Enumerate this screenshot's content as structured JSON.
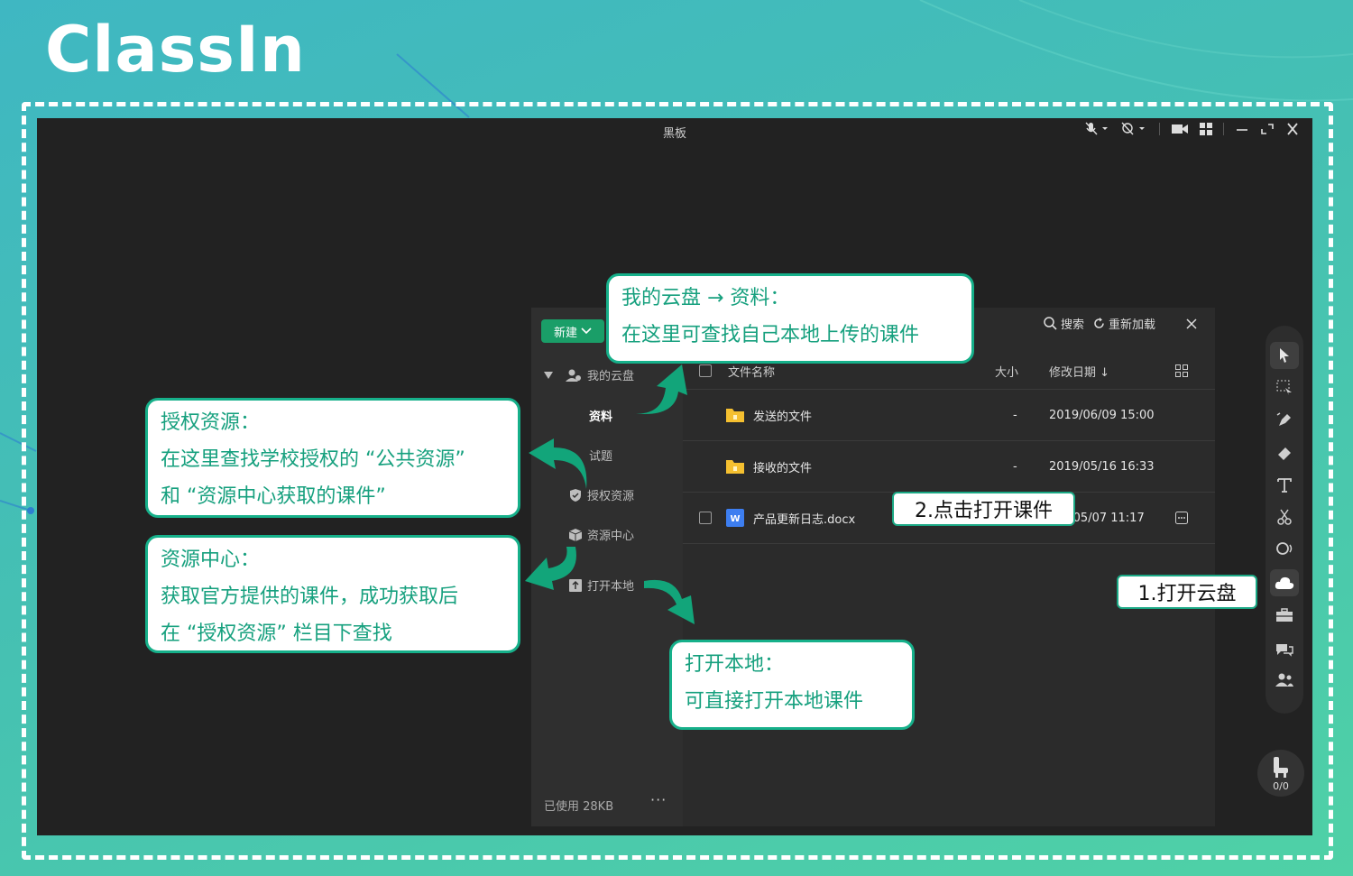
{
  "brand": {
    "logo_text": "ClassIn"
  },
  "window": {
    "title": "黑板"
  },
  "panel": {
    "new_button_label": "新建",
    "sidebar": {
      "root": "我的云盘",
      "items": [
        {
          "label": "资料",
          "selected": true
        },
        {
          "label": "试题",
          "selected": false
        },
        {
          "label": "授权资源",
          "selected": false
        },
        {
          "label": "资源中心",
          "selected": false
        },
        {
          "label": "打开本地",
          "selected": false
        }
      ],
      "used_storage": "已使用 28KB",
      "more_label": "···"
    },
    "actions": {
      "search": "搜索",
      "reload": "重新加载"
    },
    "columns": {
      "name": "文件名称",
      "size": "大小",
      "modified": "修改日期 ↓"
    },
    "rows": [
      {
        "name": "发送的文件",
        "type": "folder",
        "size": "-",
        "modified": "2019/06/09 15:00"
      },
      {
        "name": "接收的文件",
        "type": "folder",
        "size": "-",
        "modified": "2019/05/16 16:33"
      },
      {
        "name": "产品更新日志.docx",
        "type": "docx",
        "size": "",
        "modified": "2/05/07 11:17"
      }
    ]
  },
  "toolbar": {
    "seat_count": "0/0"
  },
  "callouts": {
    "cloud": {
      "line1": "我的云盘 → 资料：",
      "line2": "在这里可查找自己本地上传的课件"
    },
    "auth": {
      "line1": "授权资源：",
      "line2": "在这里查找学校授权的 “公共资源”",
      "line3": "和 “资源中心获取的课件”"
    },
    "center": {
      "line1": "资源中心：",
      "line2": "获取官方提供的课件，成功获取后",
      "line3": "在 “授权资源” 栏目下查找"
    },
    "local": {
      "line1": "打开本地：",
      "line2": "可直接打开本地课件"
    }
  },
  "labels": {
    "step1": "1.打开云盘",
    "step2": "2.点击打开课件"
  },
  "colors": {
    "accent_green": "#1a9e68",
    "callout_border": "#16b08a",
    "callout_text": "#16a07e",
    "window_bg": "#222222"
  }
}
